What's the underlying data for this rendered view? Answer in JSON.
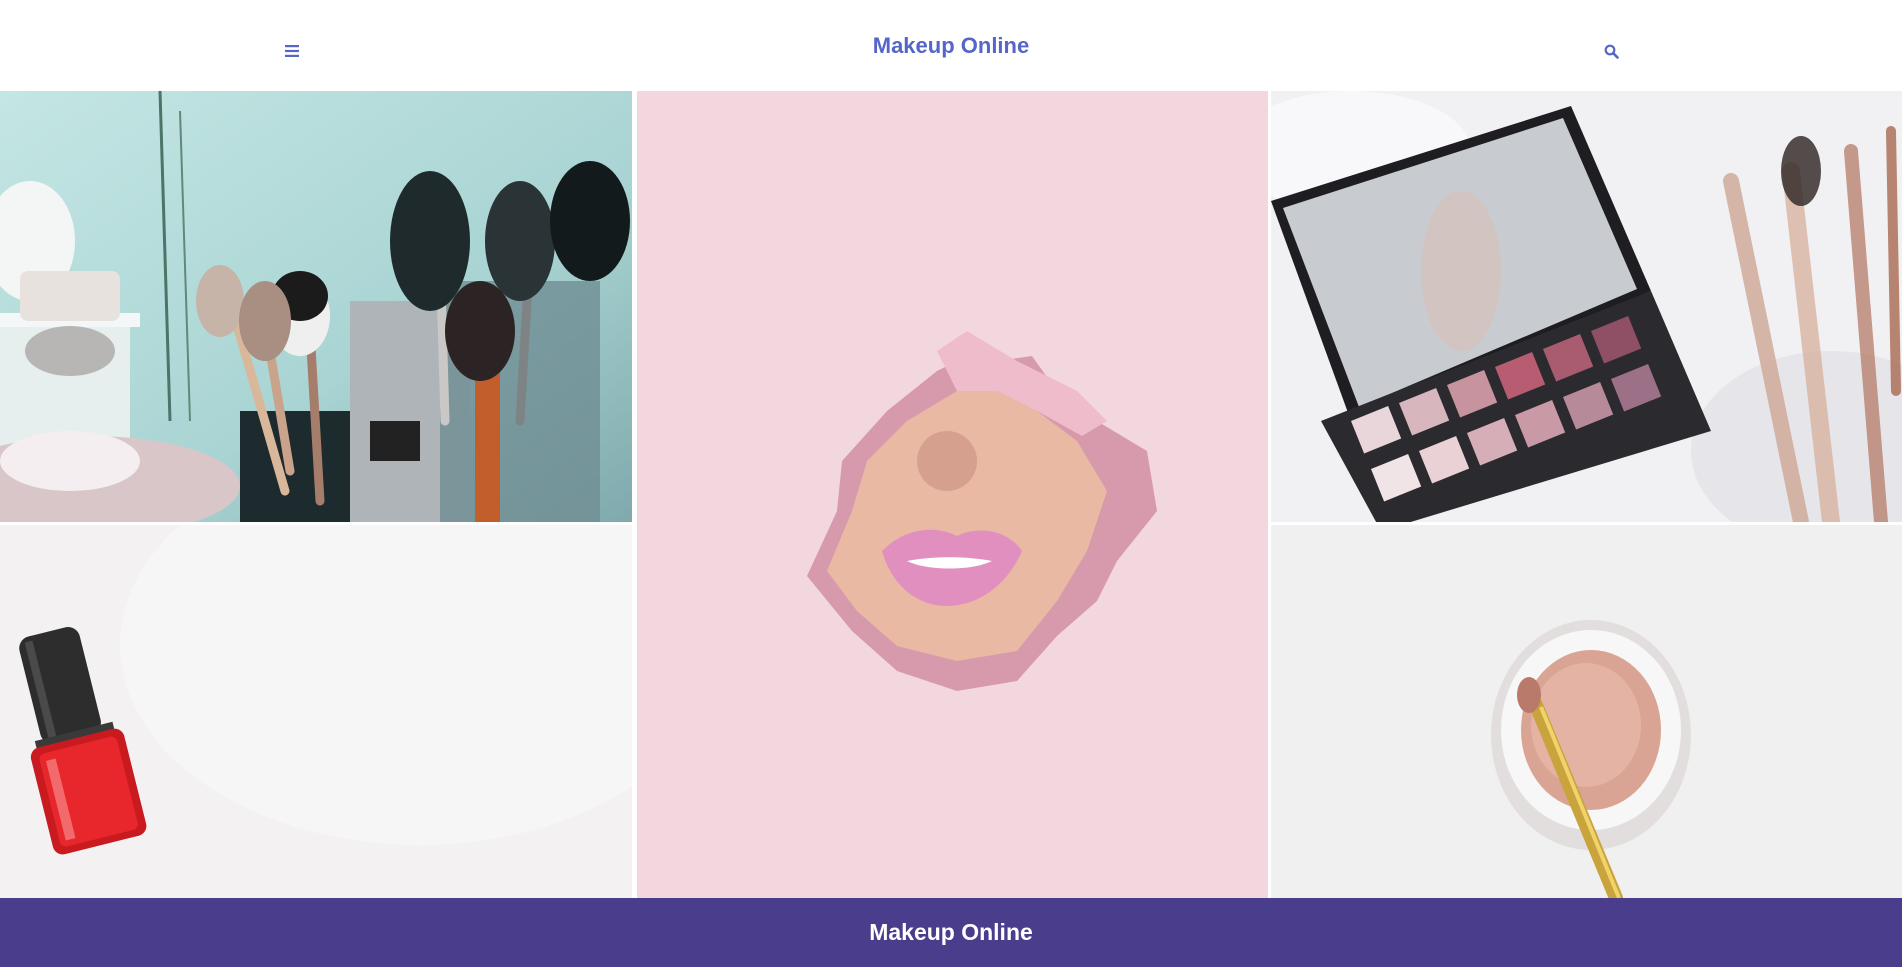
{
  "header": {
    "title": "Makeup Online",
    "menu_icon": "hamburger-menu-icon",
    "search_icon": "search-icon"
  },
  "gallery": {
    "tiles": [
      {
        "subject": "makeup-brushes-in-jars"
      },
      {
        "subject": "lips-through-torn-pink-paper"
      },
      {
        "subject": "eyeshadow-palette-with-mirror"
      },
      {
        "subject": "red-nail-polish-bottle"
      },
      {
        "subject": "loose-powder-jar-with-brush"
      }
    ]
  },
  "footer": {
    "title": "Makeup Online"
  },
  "colors": {
    "accent": "#5566c8",
    "footer_bg": "#4a3d8c",
    "background": "#ffffff"
  }
}
